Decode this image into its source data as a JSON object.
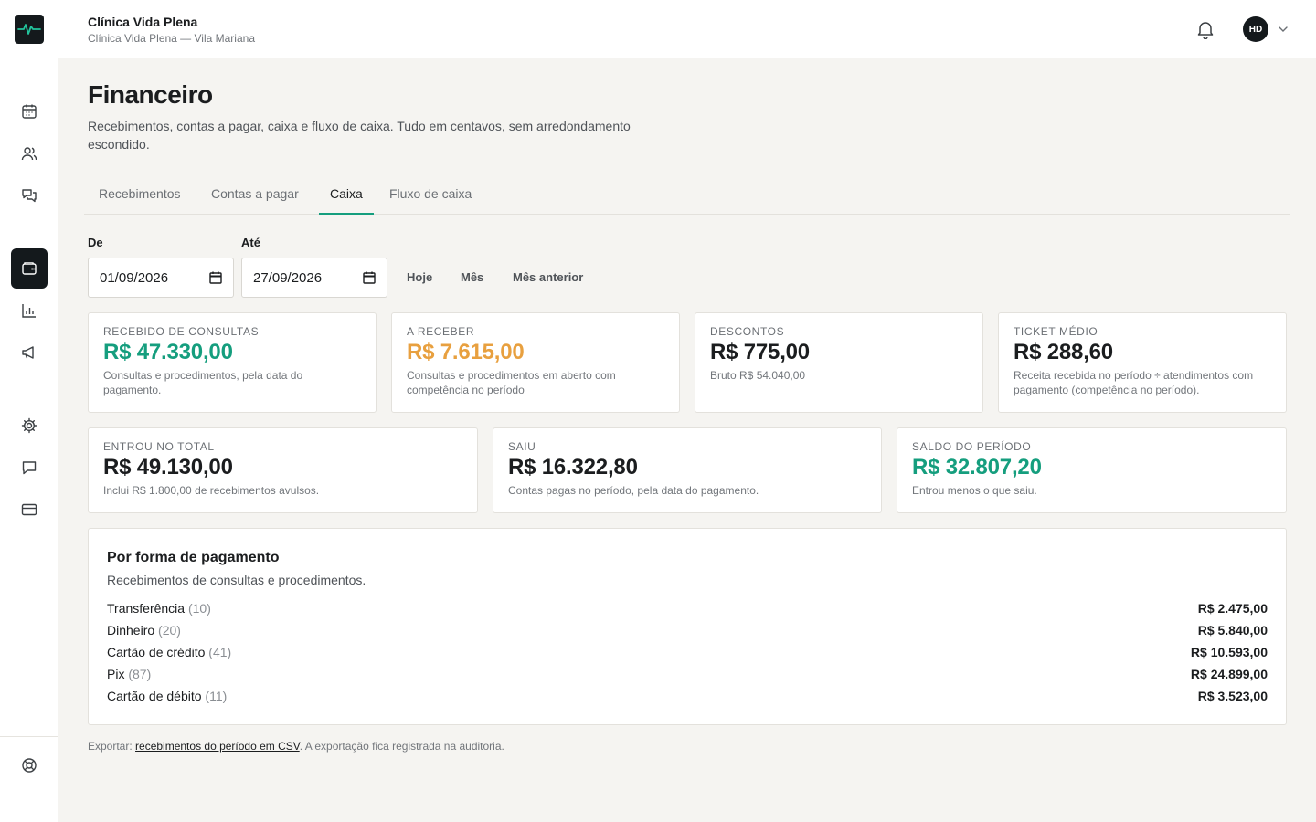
{
  "sidebar": {
    "logo_icon": "heartbeat-icon",
    "items": [
      {
        "icon": "calendar-icon"
      },
      {
        "icon": "users-icon"
      },
      {
        "icon": "chat-bubbles-icon"
      },
      {
        "icon": "wallet-icon",
        "active": true
      },
      {
        "icon": "bar-chart-icon"
      },
      {
        "icon": "megaphone-icon"
      },
      {
        "icon": "gear-icon"
      },
      {
        "icon": "message-icon"
      },
      {
        "icon": "credit-card-icon"
      },
      {
        "icon": "lifebuoy-icon"
      }
    ]
  },
  "header": {
    "clinic_name": "Clínica Vida Plena",
    "clinic_location": "Clínica Vida Plena — Vila Mariana",
    "avatar_initials": "HD"
  },
  "page": {
    "title": "Financeiro",
    "description": "Recebimentos, contas a pagar, caixa e fluxo de caixa. Tudo em centavos, sem arredondamento escondido."
  },
  "tabs": [
    "Recebimentos",
    "Contas a pagar",
    "Caixa",
    "Fluxo de caixa"
  ],
  "active_tab": "Caixa",
  "filters": {
    "from_label": "De",
    "from_value": "01/09/2026",
    "to_label": "Até",
    "to_value": "27/09/2026",
    "quick": [
      "Hoje",
      "Mês",
      "Mês anterior"
    ]
  },
  "cards_top": [
    {
      "label": "Recebido de consultas",
      "value": "R$ 47.330,00",
      "note": "Consultas e procedimentos, pela data do pagamento.",
      "color": "#159e7e"
    },
    {
      "label": "A receber",
      "value": "R$ 7.615,00",
      "note": "Consultas e procedimentos em aberto com competência no período",
      "color": "#e8a03f"
    },
    {
      "label": "Descontos",
      "value": "R$ 775,00",
      "note": "Bruto R$ 54.040,00",
      "color": "#1b1d1f"
    },
    {
      "label": "Ticket médio",
      "value": "R$ 288,60",
      "note": "Receita recebida no período ÷ atendimentos com pagamento (competência no período).",
      "color": "#1b1d1f"
    }
  ],
  "cards_bottom": [
    {
      "label": "Entrou no total",
      "value": "R$ 49.130,00",
      "note": "Inclui R$ 1.800,00 de recebimentos avulsos.",
      "color": "#1b1d1f"
    },
    {
      "label": "Saiu",
      "value": "R$ 16.322,80",
      "note": "Contas pagas no período, pela data do pagamento.",
      "color": "#1b1d1f"
    },
    {
      "label": "Saldo do período",
      "value": "R$ 32.807,20",
      "note": "Entrou menos o que saiu.",
      "color": "#159e7e"
    }
  ],
  "payments": {
    "title": "Por forma de pagamento",
    "subtitle": "Recebimentos de consultas e procedimentos.",
    "rows": [
      {
        "name": "Transferência",
        "count": "(10)",
        "amount": "R$ 2.475,00"
      },
      {
        "name": "Dinheiro",
        "count": "(20)",
        "amount": "R$ 5.840,00"
      },
      {
        "name": "Cartão de crédito",
        "count": "(41)",
        "amount": "R$ 10.593,00"
      },
      {
        "name": "Pix",
        "count": "(87)",
        "amount": "R$ 24.899,00"
      },
      {
        "name": "Cartão de débito",
        "count": "(11)",
        "amount": "R$ 3.523,00"
      }
    ]
  },
  "footer": {
    "prefix": "Exportar: ",
    "link": "recebimentos do período em CSV",
    "suffix": ". A exportação fica registrada na auditoria."
  }
}
